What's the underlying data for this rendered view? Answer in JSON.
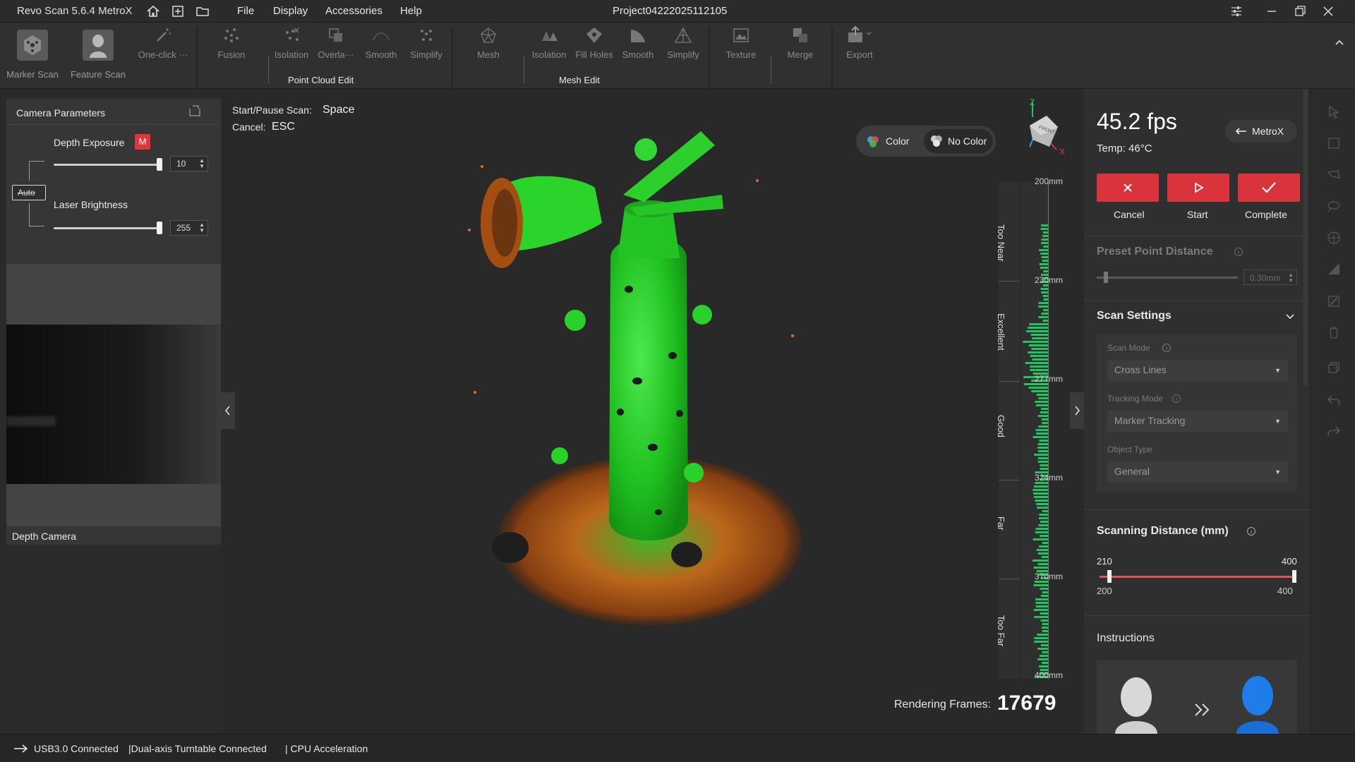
{
  "app": {
    "title": "Revo Scan 5.6.4 MetroX",
    "project": "Project04222025112105"
  },
  "menu": [
    "File",
    "Display",
    "Accessories",
    "Help"
  ],
  "toolbar": {
    "marker_scan": "Marker Scan",
    "feature_scan": "Feature Scan",
    "one_click": "One-click ···",
    "fusion": "Fusion",
    "pc_isolation": "Isolation",
    "pc_overlap": "Overla···",
    "pc_smooth": "Smooth",
    "pc_simplify": "Simplify",
    "mesh": "Mesh",
    "m_isolation": "Isolation",
    "m_fill_holes": "Fill Holes",
    "m_smooth": "Smooth",
    "m_simplify": "Simplify",
    "texture": "Texture",
    "merge": "Merge",
    "export": "Export",
    "group_point_cloud": "Point Cloud Edit",
    "group_mesh": "Mesh Edit"
  },
  "left_panel": {
    "title": "Camera Parameters",
    "depth_exposure_label": "Depth Exposure",
    "depth_exposure_badge": "M",
    "depth_exposure_value": "10",
    "depth_exposure_level": 1.0,
    "auto_label": "Auto",
    "laser_brightness_label": "Laser Brightness",
    "laser_brightness_value": "255",
    "laser_brightness_level": 1.0,
    "depth_camera_label": "Depth Camera"
  },
  "viewport": {
    "hint_pause_label": "Start/Pause Scan:",
    "hint_pause_key": "Space",
    "hint_cancel_label": "Cancel:",
    "hint_cancel_key": "ESC",
    "color_label": "Color",
    "no_color_label": "No Color",
    "gizmo_front": "FRONT",
    "gizmo_z": "Z",
    "gizmo_x": "X",
    "distance_zones": [
      "Too Near",
      "Excellent",
      "Good",
      "Far",
      "Too Far"
    ],
    "distance_ticks": [
      "200mm",
      "230mm",
      "277mm",
      "324mm",
      "370mm",
      "400mm"
    ],
    "rendering_label": "Rendering Frames:",
    "rendering_value": "17679"
  },
  "right_panel": {
    "fps": "45.2 fps",
    "temp": "Temp:  46°C",
    "device_button": "MetroX",
    "cancel": "Cancel",
    "start": "Start",
    "complete": "Complete",
    "preset_point_distance": "Preset Point Distance",
    "preset_value": "0.30mm",
    "scan_settings": "Scan Settings",
    "scan_mode_label": "Scan Mode",
    "scan_mode_value": "Cross Lines",
    "tracking_mode_label": "Tracking Mode",
    "tracking_mode_value": "Marker Tracking",
    "object_type_label": "Object Type",
    "object_type_value": "General",
    "scanning_distance": "Scanning Distance (mm)",
    "dist_low_set": "210",
    "dist_high_set": "400",
    "dist_min": "200",
    "dist_max": "400",
    "instructions": "Instructions"
  },
  "status": {
    "usb": "USB3.0 Connected",
    "turntable": "|Dual-axis Turntable Connected",
    "cpu": "| CPU Acceleration"
  },
  "colors": {
    "accent_red": "#d9343c",
    "scan_green": "#2ed12e",
    "scan_orange": "#d9741c",
    "histogram_green": "#21c45e"
  }
}
